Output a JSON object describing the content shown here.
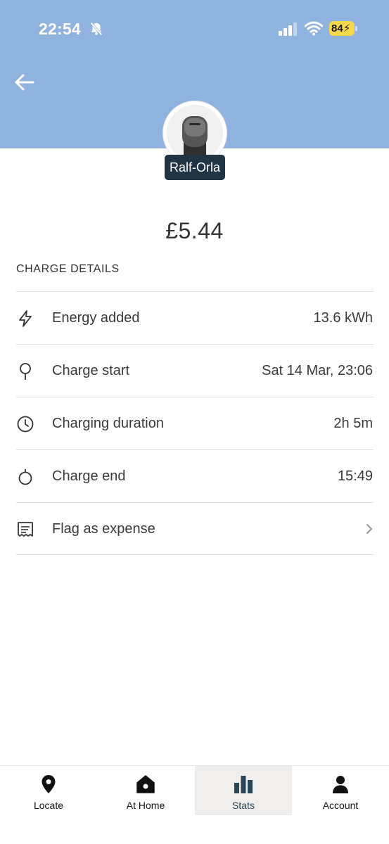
{
  "status_bar": {
    "time": "22:54",
    "battery": "84"
  },
  "header": {
    "charger_name": "Ralf-Orla"
  },
  "charge": {
    "price": "£5.44"
  },
  "details": {
    "section_title": "CHARGE DETAILS",
    "rows": [
      {
        "icon": "lightning-icon",
        "label": "Energy added",
        "value": "13.6 kWh"
      },
      {
        "icon": "pin-icon",
        "label": "Charge start",
        "value": "Sat 14 Mar, 23:06"
      },
      {
        "icon": "clock-icon",
        "label": "Charging duration",
        "value": "2h 5m"
      },
      {
        "icon": "stopwatch-icon",
        "label": "Charge end",
        "value": "15:49"
      },
      {
        "icon": "receipt-icon",
        "label": "Flag as expense",
        "value": ""
      }
    ]
  },
  "tabs": [
    {
      "icon": "location-pin-icon",
      "label": "Locate",
      "active": false
    },
    {
      "icon": "home-icon",
      "label": "At Home",
      "active": false
    },
    {
      "icon": "bar-chart-icon",
      "label": "Stats",
      "active": true
    },
    {
      "icon": "person-icon",
      "label": "Account",
      "active": false
    }
  ],
  "colors": {
    "header_bg": "#8fb3de",
    "name_badge": "#1f3444",
    "battery": "#f6d84a",
    "active_tab_bg": "#efeeec",
    "stats_icon": "#2a4556"
  }
}
